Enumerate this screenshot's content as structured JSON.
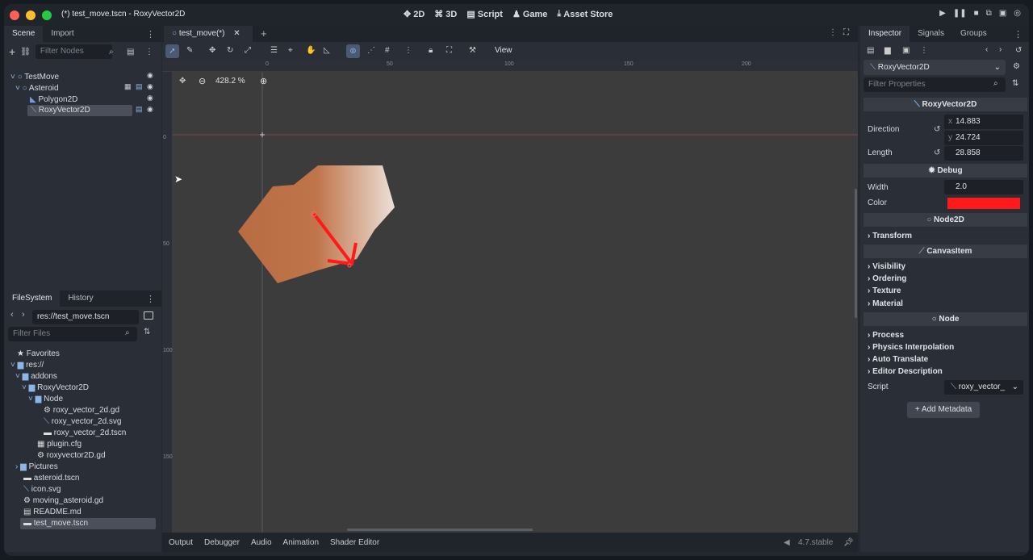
{
  "window": {
    "title": "(*) test_move.tscn - RoxyVector2D"
  },
  "mainnav": [
    {
      "label": "2D",
      "icon": "2d-icon",
      "active": true
    },
    {
      "label": "3D",
      "icon": "3d-icon"
    },
    {
      "label": "Script",
      "icon": "script-icon"
    },
    {
      "label": "Game",
      "icon": "game-icon"
    },
    {
      "label": "Asset Store",
      "icon": "asset-store-icon"
    }
  ],
  "scene_panel": {
    "tabs": [
      "Scene",
      "Import"
    ],
    "filter_placeholder": "Filter Nodes",
    "nodes": [
      {
        "name": "TestMove",
        "icon": "node2d-icon"
      },
      {
        "name": "Asteroid",
        "icon": "node2d-icon"
      },
      {
        "name": "Polygon2D",
        "icon": "polygon2d-icon"
      },
      {
        "name": "RoxyVector2D",
        "icon": "roxy-vector-icon",
        "selected": true
      }
    ]
  },
  "filesystem": {
    "tabs": [
      "FileSystem",
      "History"
    ],
    "path": "res://test_move.tscn",
    "filter_placeholder": "Filter Files",
    "items": [
      {
        "label": "Favorites",
        "icon": "star-icon"
      },
      {
        "label": "res://",
        "icon": "folder-icon"
      },
      {
        "label": "addons",
        "icon": "folder-icon"
      },
      {
        "label": "RoxyVector2D",
        "icon": "folder-icon"
      },
      {
        "label": "Node",
        "icon": "folder-icon"
      },
      {
        "label": "roxy_vector_2d.gd",
        "icon": "gear-icon"
      },
      {
        "label": "roxy_vector_2d.svg",
        "icon": "roxy-vector-icon"
      },
      {
        "label": "roxy_vector_2d.tscn",
        "icon": "scene-icon"
      },
      {
        "label": "plugin.cfg",
        "icon": "config-icon"
      },
      {
        "label": "roxyvector2D.gd",
        "icon": "gear-icon"
      },
      {
        "label": "Pictures",
        "icon": "folder-icon"
      },
      {
        "label": "asteroid.tscn",
        "icon": "scene-icon"
      },
      {
        "label": "icon.svg",
        "icon": "roxy-vector-icon"
      },
      {
        "label": "moving_asteroid.gd",
        "icon": "gear-icon"
      },
      {
        "label": "README.md",
        "icon": "doc-icon"
      },
      {
        "label": "test_move.tscn",
        "icon": "scene-icon",
        "selected": true
      }
    ]
  },
  "editor": {
    "tab": "test_move(*)",
    "view_menu": "View",
    "zoom": "428.2 %",
    "ruler_top": [
      "0",
      "50",
      "100",
      "150",
      "200"
    ],
    "ruler_left": [
      "0",
      "50",
      "100",
      "150"
    ]
  },
  "inspector": {
    "tabs": [
      "Inspector",
      "Signals",
      "Groups"
    ],
    "node": "RoxyVector2D",
    "filter_placeholder": "Filter Properties",
    "class_header": "RoxyVector2D",
    "direction_label": "Direction",
    "direction_x": "14.883",
    "direction_y": "24.724",
    "x_letter": "x",
    "y_letter": "y",
    "length_label": "Length",
    "length": "28.858",
    "debug_header": "Debug",
    "width_label": "Width",
    "width": "2.0",
    "color_label": "Color",
    "color_value": "#ff1a1a",
    "node2d_header": "Node2D",
    "transform": "Transform",
    "canvasitem_header": "CanvasItem",
    "canvas_sections": [
      "Visibility",
      "Ordering",
      "Texture",
      "Material"
    ],
    "node_header": "Node",
    "node_sections": [
      "Process",
      "Physics Interpolation",
      "Auto Translate",
      "Editor Description"
    ],
    "script_label": "Script",
    "script_value": "roxy_vector_",
    "add_metadata": "Add Metadata"
  },
  "bottom": {
    "tabs": [
      "Output",
      "Debugger",
      "Audio",
      "Animation",
      "Shader Editor"
    ],
    "version": "4.7.stable"
  },
  "colors": {
    "accent": "#6eb3ff",
    "vector": "#ff1a1a",
    "asteroid": "#c0744a"
  }
}
